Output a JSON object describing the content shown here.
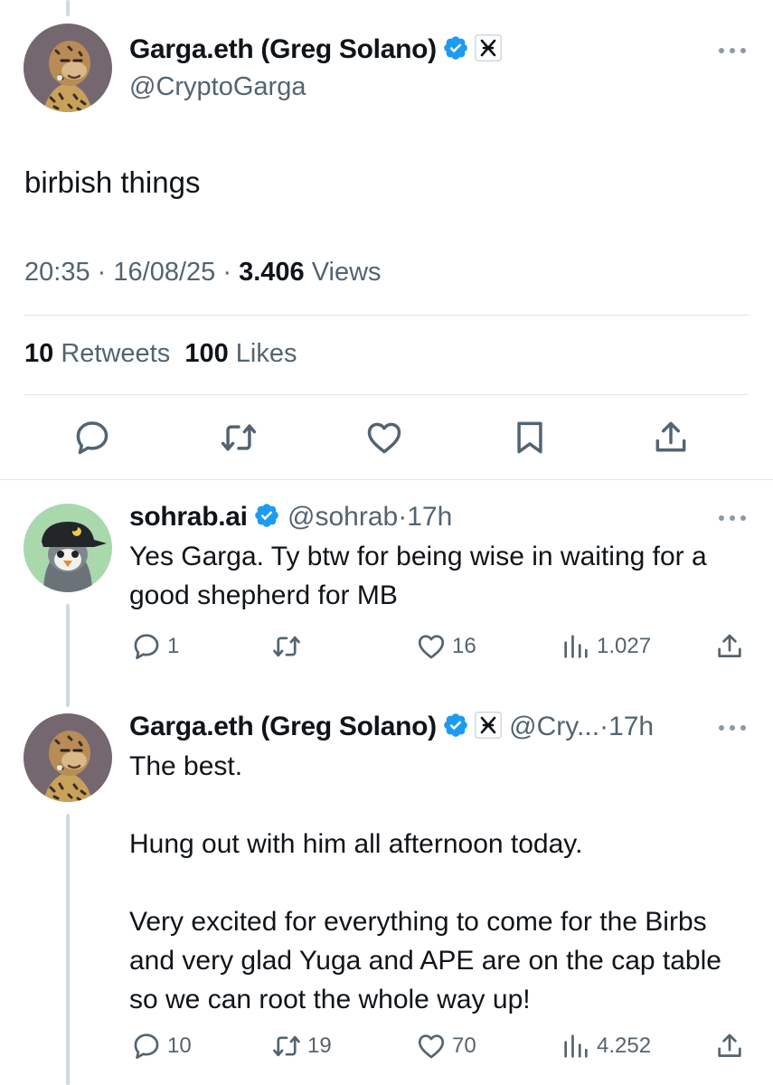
{
  "main_tweet": {
    "display_name": "Garga.eth (Greg Solano)",
    "handle": "@CryptoGarga",
    "text": "birbish things",
    "time": "20:35",
    "date": "16/08/25",
    "views_count": "3.406",
    "views_label": "Views",
    "retweets_count": "10",
    "retweets_label": "Retweets",
    "likes_count": "100",
    "likes_label": "Likes",
    "separator": "·"
  },
  "replies": [
    {
      "display_name": "sohrab.ai",
      "handle": "@sohrab",
      "age": "17h",
      "text": "Yes Garga. Ty btw for being wise in waiting for a good shepherd for MB",
      "reply_count": "1",
      "retweet_count": "",
      "like_count": "16",
      "view_count": "1.027"
    },
    {
      "display_name": "Garga.eth (Greg Solano)",
      "handle": "@Cry...",
      "age": "17h",
      "text": "The best.\n\nHung out with him all afternoon today.\n\nVery excited for everything to come for the Birbs and very glad Yuga and APE are on the cap table so we can root the whole way up!",
      "reply_count": "10",
      "retweet_count": "19",
      "like_count": "70",
      "view_count": "4.252"
    }
  ],
  "icons": {
    "verified": "verified-badge-icon",
    "affiliate": "yuga-labs-affiliate-icon",
    "more": "more-dots-icon",
    "reply": "reply-icon",
    "retweet": "retweet-icon",
    "like": "heart-icon",
    "bookmark": "bookmark-icon",
    "share": "share-icon",
    "views": "views-bar-chart-icon"
  },
  "colors": {
    "text": "#0f1419",
    "secondary": "#536471",
    "verified_blue": "#1d9bf0",
    "divider": "#dfe5e8",
    "thread_line": "#cfd9de"
  }
}
